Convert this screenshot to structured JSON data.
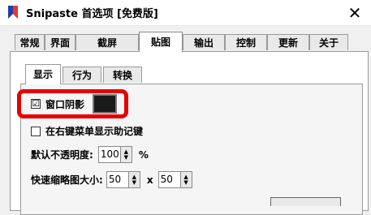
{
  "window": {
    "title": "Snipaste 首选项 [免费版]"
  },
  "icons": {
    "app": "snipaste-logo-icon",
    "close": "close-icon"
  },
  "main_tabs": [
    {
      "label": "常规"
    },
    {
      "label": "界面"
    },
    {
      "label": "截屏"
    },
    {
      "label": "贴图",
      "active": true
    },
    {
      "label": "输出"
    },
    {
      "label": "控制"
    },
    {
      "label": "更新"
    },
    {
      "label": "关于"
    }
  ],
  "sub_tabs": [
    {
      "label": "显示",
      "active": true
    },
    {
      "label": "行为"
    },
    {
      "label": "转换"
    }
  ],
  "settings": {
    "window_shadow": {
      "label": "窗口阴影",
      "checked": true,
      "check_mark": "☑",
      "color": "#1a1a1a"
    },
    "show_mnemonics": {
      "label": "在右键菜单显示助记键",
      "checked": false
    },
    "default_opacity": {
      "label": "默认不透明度:",
      "value": "100",
      "unit": "%"
    },
    "thumbnail_size": {
      "label": "快速缩略图大小:",
      "width": "50",
      "separator": "x",
      "height": "50"
    }
  },
  "accent_colors": {
    "highlight": "#e60000"
  }
}
